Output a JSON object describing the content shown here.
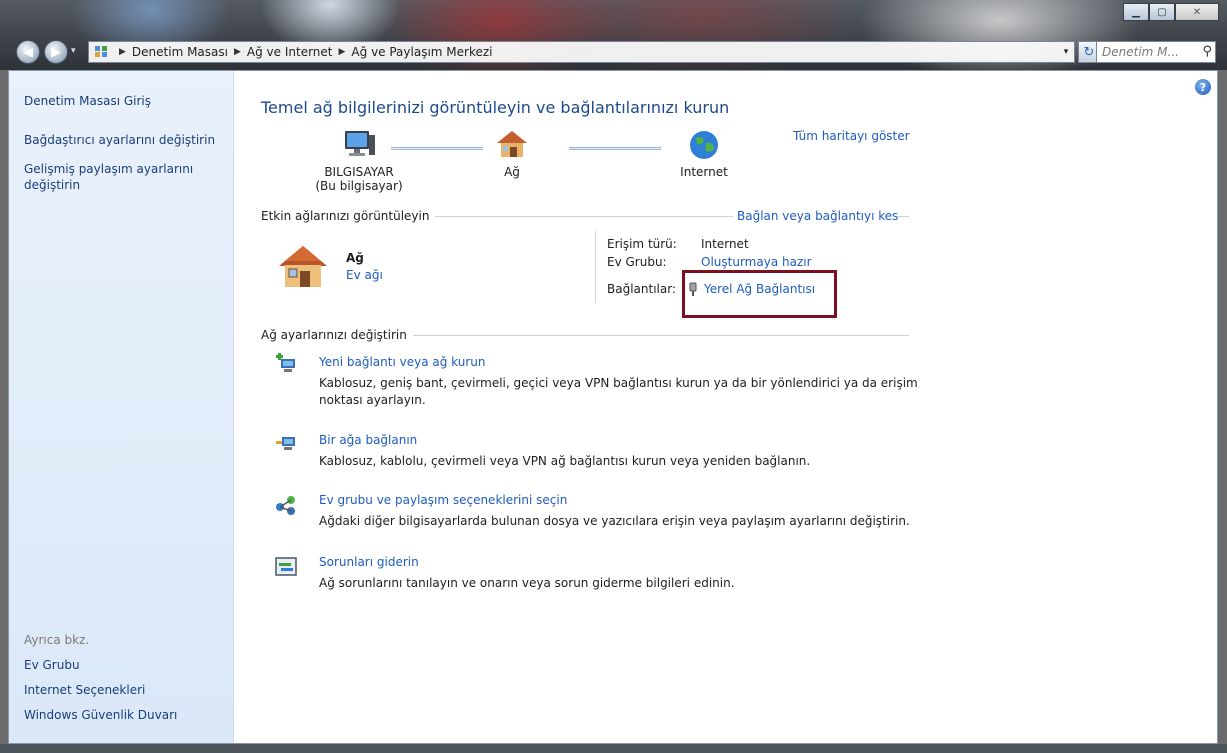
{
  "window": {
    "minimize_glyph": "▁",
    "maximize_glyph": "▢",
    "close_glyph": "✕"
  },
  "address": {
    "back_glyph": "◀",
    "forward_glyph": "▶",
    "crumbs": [
      "Denetim Masası",
      "Ağ ve Internet",
      "Ağ ve Paylaşım Merkezi"
    ],
    "dropdown_glyph": "▾",
    "refresh_glyph": "↻",
    "search_placeholder": "Denetim M...",
    "search_glyph": "⚲"
  },
  "sidebar": {
    "home": "Denetim Masası Giriş",
    "links": [
      "Bağdaştırıcı ayarlarını değiştirin",
      "Gelişmiş paylaşım ayarlarını değiştirin"
    ],
    "see_also_heading": "Ayrıca bkz.",
    "see_also": [
      "Ev Grubu",
      "Internet Seçenekleri",
      "Windows Güvenlik Duvarı"
    ]
  },
  "main": {
    "help_glyph": "?",
    "title": "Temel ağ bilgilerinizi görüntüleyin ve bağlantılarınızı kurun",
    "show_full_map": "Tüm haritayı göster",
    "map": {
      "computer": "BILGISAYAR",
      "computer_sub": "(Bu bilgisayar)",
      "network": "Ağ",
      "internet": "Internet"
    },
    "active_networks": {
      "heading": "Etkin ağlarınızı görüntüleyin",
      "connect_link": "Bağlan veya bağlantıyı kes",
      "network_name": "Ağ",
      "network_type": "Ev ağı",
      "access_type_label": "Erişim türü:",
      "access_type_value": "Internet",
      "homegroup_label": "Ev Grubu:",
      "homegroup_value": "Oluşturmaya hazır",
      "connections_label": "Bağlantılar:",
      "connections_value": "Yerel Ağ Bağlantısı"
    },
    "change_settings": {
      "heading": "Ağ ayarlarınızı değiştirin",
      "tasks": [
        {
          "title": "Yeni bağlantı veya ağ kurun",
          "desc": "Kablosuz, geniş bant, çevirmeli, geçici veya VPN bağlantısı kurun ya da bir yönlendirici ya da erişim noktası ayarlayın."
        },
        {
          "title": "Bir ağa bağlanın",
          "desc": "Kablosuz, kablolu, çevirmeli veya VPN ağ bağlantısı kurun veya yeniden bağlanın."
        },
        {
          "title": "Ev grubu ve paylaşım seçeneklerini seçin",
          "desc": "Ağdaki diğer bilgisayarlarda bulunan dosya ve yazıcılara erişin veya paylaşım ayarlarını değiştirin."
        },
        {
          "title": "Sorunları giderin",
          "desc": "Ağ sorunlarını tanılayın ve onarın veya sorun giderme bilgileri edinin."
        }
      ]
    }
  }
}
